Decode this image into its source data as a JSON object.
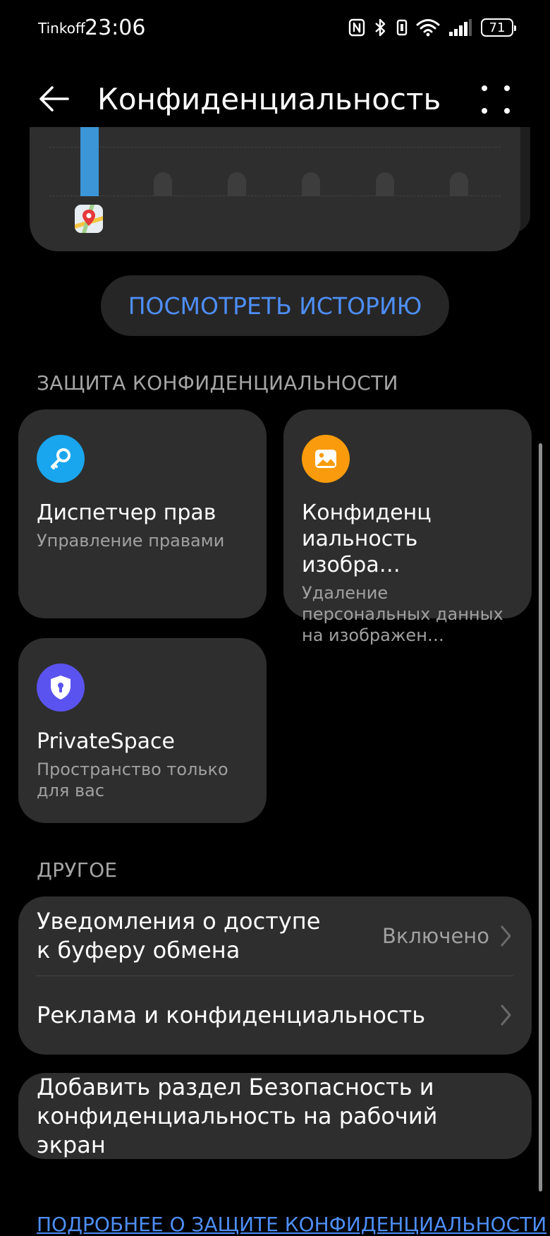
{
  "status_bar": {
    "carrier": "Tinkoff",
    "time": "23:06",
    "battery": "71",
    "icons": [
      "nfc-icon",
      "bluetooth-icon",
      "vibrate-icon",
      "wifi-icon",
      "signal-icon",
      "battery-icon"
    ]
  },
  "app_bar": {
    "title": "Конфиденциальность",
    "back_icon": "arrow-left-icon",
    "more_icon": "more-vertical-icon"
  },
  "chart": {
    "app_icon": "maps-pin-icon",
    "accent_color": "#3b95d6"
  },
  "history_button": {
    "label": "ПОСМОТРЕТЬ ИСТОРИЮ"
  },
  "privacy_section": {
    "header": "ЗАЩИТА КОНФИДЕНЦИАЛЬНОСТИ",
    "tiles": [
      {
        "title": "Диспетчер прав",
        "subtitle": "Управление правами",
        "icon": "key-icon",
        "color": "#1aa6ee"
      },
      {
        "title": "Конфиденц иальность изобра…",
        "subtitle": "Удаление персональных данных на изображен…",
        "icon": "image-icon",
        "color": "#f99b0c"
      },
      {
        "title": "PrivateSpace",
        "subtitle": "Пространство только для вас",
        "icon": "shield-lock-icon",
        "color": "#5b53f0"
      }
    ]
  },
  "other_section": {
    "header": "ДРУГОЕ",
    "items": [
      {
        "title": "Уведомления о доступе к буферу обмена",
        "value": "Включено"
      },
      {
        "title": "Реклама и конфиденциальность"
      }
    ]
  },
  "shortcut_card": {
    "title": "Добавить раздел Безопасность и конфиденциальность на рабочий экран"
  },
  "footer_link": "ПОДРОБНЕЕ О ЗАЩИТЕ КОНФИДЕНЦИАЛЬНОСТИ",
  "colors": {
    "background": "#000000",
    "card": "#2e2e2e",
    "accent": "#4e8ef7"
  }
}
